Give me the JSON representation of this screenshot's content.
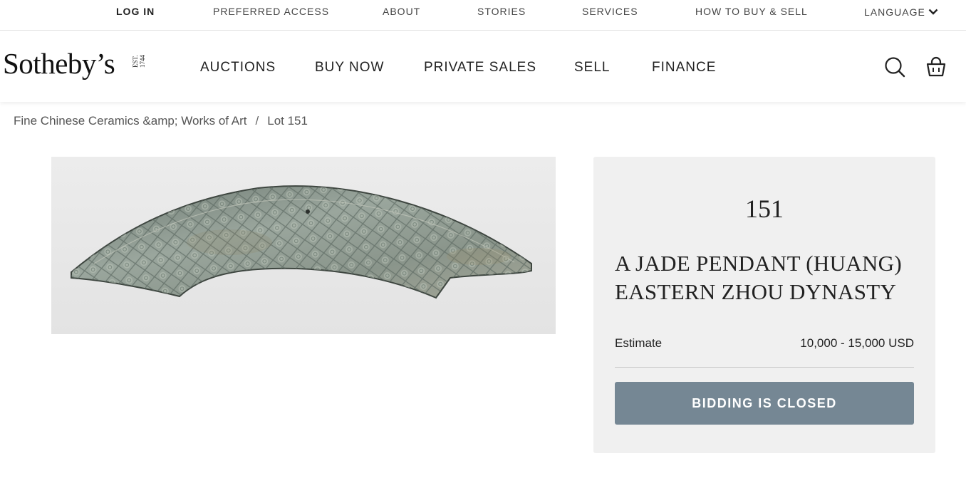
{
  "topbar": {
    "login": "LOG IN",
    "preferred_access": "PREFERRED ACCESS",
    "about": "ABOUT",
    "stories": "STORIES",
    "services": "SERVICES",
    "how_to": "HOW TO BUY & SELL",
    "language": "LANGUAGE"
  },
  "header": {
    "logo": "Sotheby’s",
    "logo_est_1": "EST.",
    "logo_est_2": "1744",
    "nav": [
      "AUCTIONS",
      "BUY NOW",
      "PRIVATE SALES",
      "SELL",
      "FINANCE"
    ],
    "icons": [
      "search-icon",
      "shopping-bag-icon"
    ]
  },
  "breadcrumb": {
    "sale": "Fine Chinese Ceramics &amp; Works of Art",
    "separator": "/",
    "lot": "Lot 151"
  },
  "lot": {
    "number": "151",
    "title_line1": "A JADE PENDANT (HUANG)",
    "title_line2": "EASTERN ZHOU DYNASTY",
    "estimate_label": "Estimate",
    "estimate_value": "10,000 - 15,000 USD",
    "bid_status": "BIDDING IS CLOSED",
    "button_color": "#758794"
  }
}
